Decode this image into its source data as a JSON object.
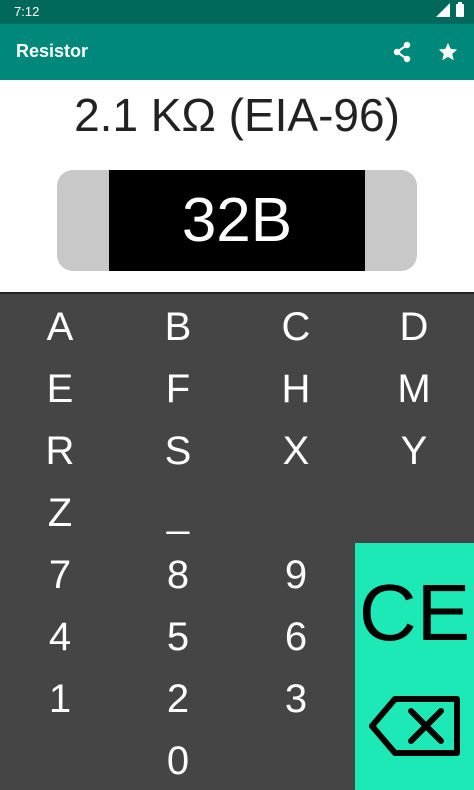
{
  "status_bar": {
    "time": "7:12"
  },
  "app_bar": {
    "title": "Resistor",
    "actions": [
      "share-icon",
      "star-icon"
    ]
  },
  "display": {
    "value": "2.1 KΩ (EIA-96)",
    "code": "32B"
  },
  "keypad": {
    "letter_rows": [
      [
        "A",
        "B",
        "C",
        "D"
      ],
      [
        "E",
        "F",
        "H",
        "M"
      ],
      [
        "R",
        "S",
        "X",
        "Y"
      ],
      [
        "Z",
        "_"
      ]
    ],
    "digit_rows": [
      [
        "7",
        "8",
        "9"
      ],
      [
        "4",
        "5",
        "6"
      ],
      [
        "1",
        "2",
        "3"
      ],
      [
        "0"
      ]
    ],
    "ce_label": "CE",
    "backspace_icon": "backspace-icon"
  },
  "colors": {
    "status_bar": "#00695c",
    "app_bar": "#00897b",
    "keypad_bg": "#454545",
    "accent_panel": "#1de9b6",
    "resistor_body": "#000000",
    "resistor_caps": "#c8c8c8"
  }
}
